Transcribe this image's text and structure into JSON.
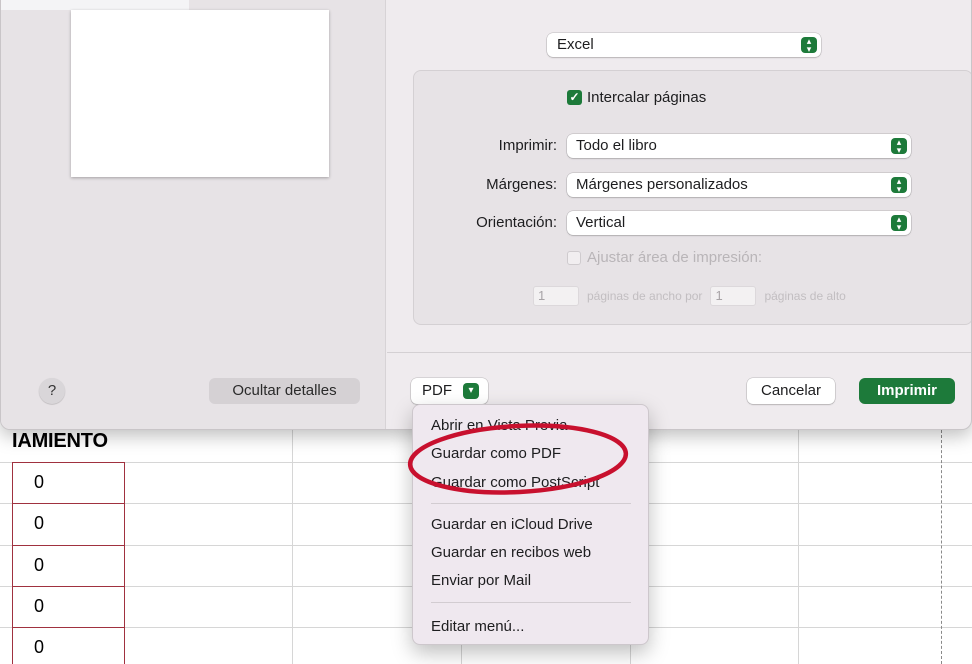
{
  "dialog": {
    "app_select": "Excel",
    "collate_label": "Intercalar páginas",
    "collate_checked": true,
    "print_label": "Imprimir:",
    "print_value": "Todo el libro",
    "margins_label": "Márgenes:",
    "margins_value": "Márgenes personalizados",
    "orientation_label": "Orientación:",
    "orientation_value": "Vertical",
    "fit_label": "Ajustar área de impresión:",
    "fit_width_value": "1",
    "fit_width_label": "páginas de ancho por",
    "fit_height_value": "1",
    "fit_height_label": "páginas de alto",
    "help_label": "?",
    "hide_details_label": "Ocultar detalles",
    "pdf_label": "PDF",
    "cancel_label": "Cancelar",
    "print_button_label": "Imprimir"
  },
  "pdf_menu": {
    "items": [
      "Abrir en Vista Previa",
      "Guardar como PDF",
      "Guardar como PostScript",
      "Guardar en iCloud Drive",
      "Guardar en recibos web",
      "Enviar por Mail",
      "Editar menú..."
    ]
  },
  "sheet": {
    "title": "IAMIENTO",
    "values": [
      "0",
      "0",
      "0",
      "0",
      "0"
    ]
  },
  "colors": {
    "accent": "#1d7a3a",
    "annotation": "#c8102e"
  }
}
